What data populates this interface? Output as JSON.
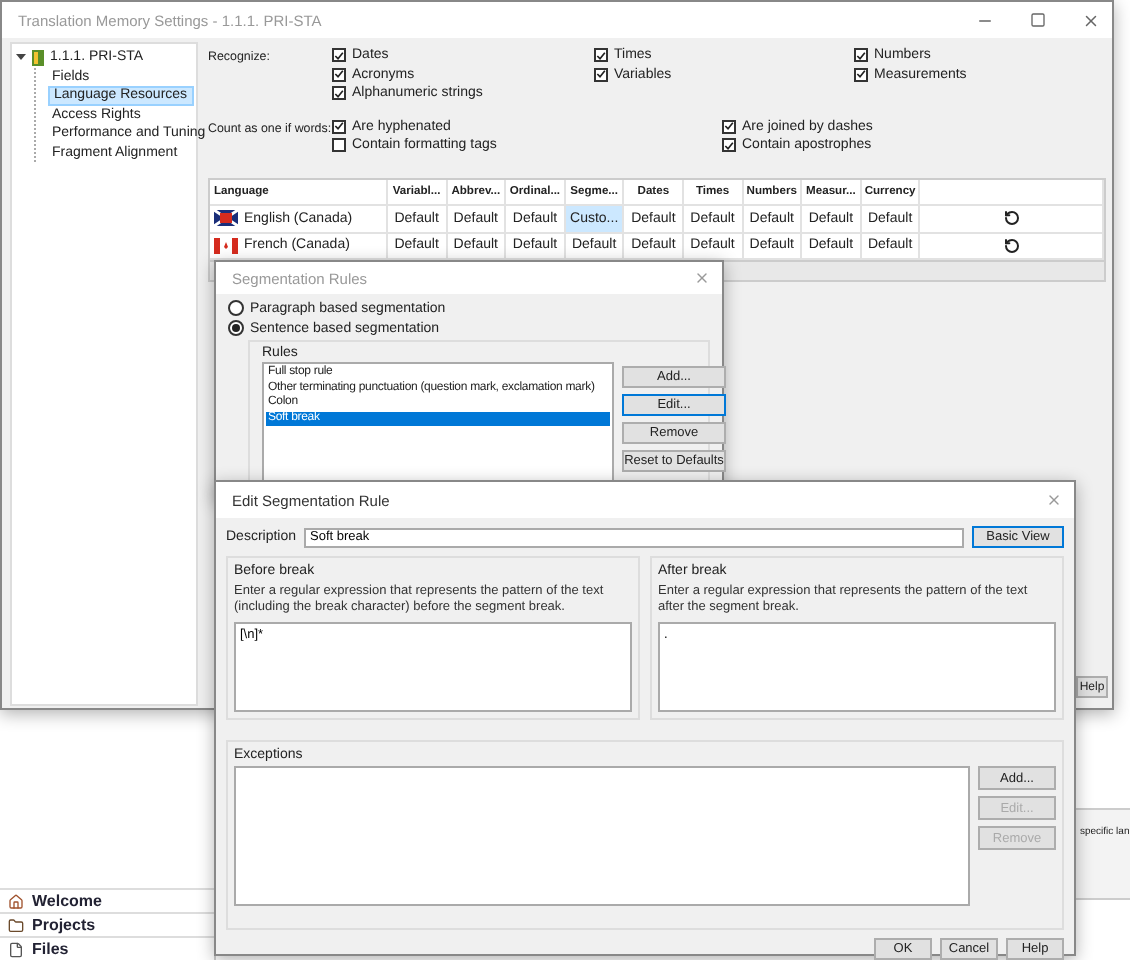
{
  "background_app": {
    "nav": [
      {
        "label": "Welcome"
      },
      {
        "label": "Projects"
      },
      {
        "label": "Files"
      }
    ],
    "side_text": "specific lan"
  },
  "main_window": {
    "title": "Translation Memory Settings - 1.1.1. PRI-STA",
    "tree": {
      "label": "1.1.1. PRI-STA",
      "expanded": true,
      "children": [
        {
          "label": "Fields",
          "selected": false
        },
        {
          "label": "Language Resources",
          "selected": true
        },
        {
          "label": "Access Rights",
          "selected": false
        },
        {
          "label": "Performance and Tuning",
          "selected": false
        },
        {
          "label": "Fragment Alignment",
          "selected": false
        }
      ]
    },
    "recognize": {
      "label": "Recognize:",
      "columns": [
        [
          {
            "label": "Dates",
            "checked": true
          },
          {
            "label": "Acronyms",
            "checked": true
          },
          {
            "label": "Alphanumeric strings",
            "checked": true
          }
        ],
        [
          {
            "label": "Times",
            "checked": true
          },
          {
            "label": "Variables",
            "checked": true
          }
        ],
        [
          {
            "label": "Numbers",
            "checked": true
          },
          {
            "label": "Measurements",
            "checked": true
          }
        ]
      ]
    },
    "count_as_one": {
      "label": "Count as one if words:",
      "columns": [
        [
          {
            "label": "Are hyphenated",
            "checked": true
          },
          {
            "label": "Contain formatting tags",
            "checked": false
          }
        ],
        [
          {
            "label": "Are joined by dashes",
            "checked": true
          },
          {
            "label": "Contain apostrophes",
            "checked": true
          }
        ]
      ]
    },
    "table": {
      "columns": [
        "Language",
        "Variabl...",
        "Abbrev...",
        "Ordinal...",
        "Segme...",
        "Dates",
        "Times",
        "Numbers",
        "Measur...",
        "Currency"
      ],
      "rows": [
        {
          "kind": "union",
          "cells": [
            {
              "text": "English (Canada)",
              "selected": false
            },
            {
              "text": "Default",
              "selected": false
            },
            {
              "text": "Default",
              "selected": false
            },
            {
              "text": "Default",
              "selected": false
            },
            {
              "text": "Custo...",
              "selected": true
            },
            {
              "text": "Default",
              "selected": false
            },
            {
              "text": "Default",
              "selected": false
            },
            {
              "text": "Default",
              "selected": false
            },
            {
              "text": "Default",
              "selected": false
            },
            {
              "text": "Default",
              "selected": false
            }
          ]
        },
        {
          "kind": "maple",
          "cells": [
            {
              "text": "French (Canada)",
              "selected": false
            },
            {
              "text": "Default",
              "selected": false
            },
            {
              "text": "Default",
              "selected": false
            },
            {
              "text": "Default",
              "selected": false
            },
            {
              "text": "Default",
              "selected": false
            },
            {
              "text": "Default",
              "selected": false
            },
            {
              "text": "Default",
              "selected": false
            },
            {
              "text": "Default",
              "selected": false
            },
            {
              "text": "Default",
              "selected": false
            },
            {
              "text": "Default",
              "selected": false
            }
          ]
        }
      ]
    },
    "help_button": "Help"
  },
  "segmentation_dialog": {
    "title": "Segmentation Rules",
    "modes": [
      {
        "label": "Paragraph based segmentation",
        "selected": false
      },
      {
        "label": "Sentence based segmentation",
        "selected": true
      }
    ],
    "rules_label": "Rules",
    "rules": [
      {
        "label": "Full stop rule",
        "selected": false
      },
      {
        "label": "Other terminating punctuation (question mark, exclamation mark)",
        "selected": false
      },
      {
        "label": "Colon",
        "selected": false
      },
      {
        "label": "Soft break",
        "selected": true
      }
    ],
    "buttons": [
      {
        "label": "Add...",
        "focused": false
      },
      {
        "label": "Edit...",
        "focused": true
      },
      {
        "label": "Remove",
        "focused": false
      },
      {
        "label": "Reset to Defaults",
        "focused": false
      }
    ]
  },
  "edit_dialog": {
    "title": "Edit Segmentation Rule",
    "description_label": "Description",
    "description": "Soft break",
    "view_button": "Basic View",
    "before": {
      "label": "Before break",
      "hint": "Enter a regular expression that represents the pattern of the text (including the break character) before the segment break.",
      "value": "[\\n]*"
    },
    "after": {
      "label": "After break",
      "hint": "Enter a regular expression that represents the pattern of the text after the segment break.",
      "value": "."
    },
    "exceptions_label": "Exceptions",
    "exception_buttons": [
      {
        "label": "Add...",
        "disabled": false
      },
      {
        "label": "Edit...",
        "disabled": true
      },
      {
        "label": "Remove",
        "disabled": true
      }
    ],
    "footer_buttons": [
      "OK",
      "Cancel",
      "Help"
    ]
  }
}
